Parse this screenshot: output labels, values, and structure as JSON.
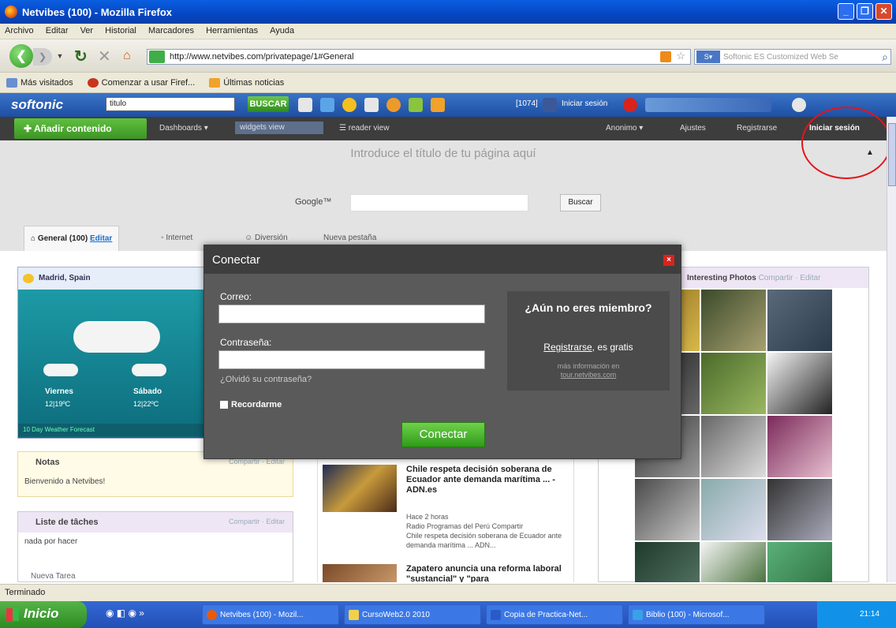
{
  "window": {
    "title": "Netvibes (100) - Mozilla Firefox"
  },
  "menu": [
    "Archivo",
    "Editar",
    "Ver",
    "Historial",
    "Marcadores",
    "Herramientas",
    "Ayuda"
  ],
  "nav": {
    "url": "http://www.netvibes.com/privatepage/1#General",
    "search_placeholder": "Softonic ES Customized Web Se"
  },
  "bookmarks": [
    "Más visitados",
    "Comenzar a usar Firef...",
    "Últimas noticias"
  ],
  "softonic": {
    "logo": "softonic",
    "input_value": "titulo",
    "search_label": "BUSCAR",
    "count": "[1074]",
    "login": "Iniciar sesión"
  },
  "netvibes": {
    "add_content": "Añadir contenido",
    "dashboards": "Dashboards ▾",
    "widgets_view": "widgets view",
    "reader_view": "reader view",
    "anonymous": "Anonimo ▾",
    "settings": "Ajustes",
    "register": "Registrarse",
    "login": "Iniciar sesión",
    "page_title_placeholder": "Introduce el título de tu página aquí",
    "google_label": "Google™",
    "search_button": "Buscar",
    "tabs": [
      {
        "label": "General (100)",
        "edit": "Editar"
      },
      {
        "label": "Internet"
      },
      {
        "label": "Diversión"
      },
      {
        "label": "Nueva pestaña"
      }
    ]
  },
  "weather": {
    "location": "Madrid, Spain",
    "days": [
      {
        "day": "Viernes",
        "temp": "12|19ºC"
      },
      {
        "day": "Sábado",
        "temp": "12|22ºC"
      }
    ],
    "footer": "10 Day Weather Forecast"
  },
  "notes": {
    "title": "Notas",
    "links": "Compartir · Editar",
    "text": "Bienvenido a Netvibes!"
  },
  "todo": {
    "title": "Liste de tâches",
    "links": "Compartir · Editar",
    "text": "nada por hacer",
    "new_task": "Nueva Tarea"
  },
  "news": {
    "headline1": "Chile respeta decisión soberana de Ecuador ante demanda marítima ... - ADN.es",
    "hace1": "Hace 2 horas",
    "source": "Radio Programas del Perú",
    "share": "Compartir",
    "snippet": "Chile respeta decisión soberana de Ecuador ante demanda marítima ... ADN...",
    "headline2": "Zapatero anuncia una reforma laboral \"sustancial\" y \"para"
  },
  "photos": {
    "title": "Interesting Photos",
    "links": "Compartir · Editar"
  },
  "modal": {
    "title": "Conectar",
    "close": "×",
    "email_label": "Correo:",
    "email_value": "",
    "password_label": "Contraseña:",
    "password_value": "",
    "forgot": "¿Olvidó su contraseña?",
    "remember": "Recordarme",
    "submit": "Conectar",
    "member_question": "¿Aún no eres miembro?",
    "register_link": "Registrarse",
    "register_suffix": ", es gratis",
    "more_info": "más información en",
    "more_info_link": "tour.netvibes.com"
  },
  "status": "Terminado",
  "taskbar": {
    "start": "Inicio",
    "tasks": [
      "Netvibes (100) - Mozil...",
      "CursoWeb2.0 2010",
      "Copia de Practica-Net...",
      "Biblio (100) - Microsof..."
    ],
    "clock": "21:14"
  }
}
